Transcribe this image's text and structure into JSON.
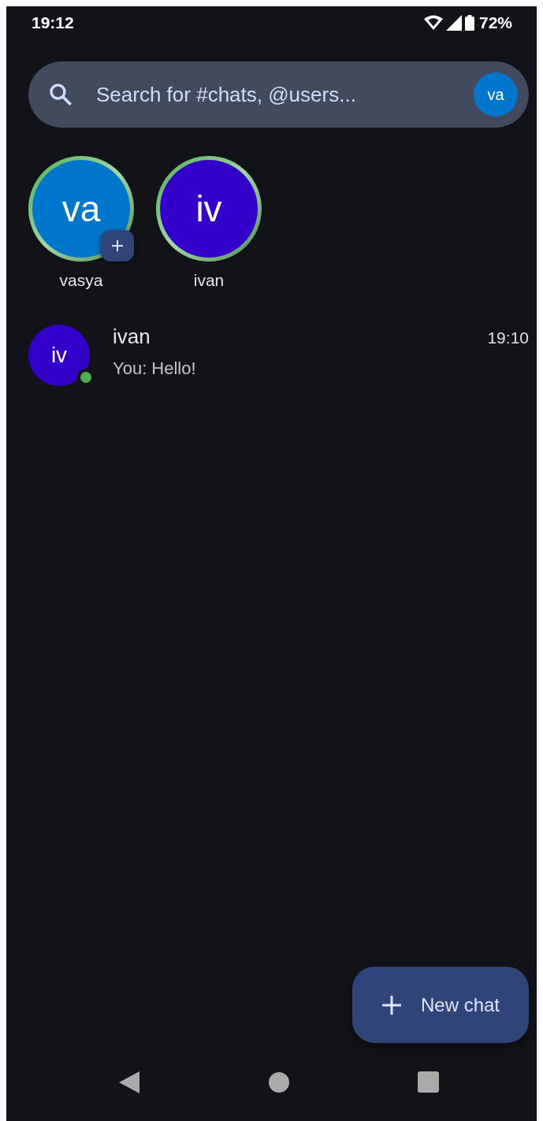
{
  "status_bar": {
    "time": "19:12",
    "battery": "72%"
  },
  "search": {
    "placeholder": "Search for #chats, @users...",
    "avatar": {
      "initials": "va",
      "color": "#0077cc"
    }
  },
  "stories": [
    {
      "initials": "va",
      "name": "vasya",
      "color": "#0077cc",
      "add_badge": true
    },
    {
      "initials": "iv",
      "name": "ivan",
      "color": "#3300cc",
      "add_badge": false
    }
  ],
  "chats": [
    {
      "initials": "iv",
      "color": "#3300cc",
      "online": true,
      "name": "ivan",
      "preview": "You: Hello!",
      "time": "19:10"
    }
  ],
  "fab": {
    "label": "New chat"
  }
}
